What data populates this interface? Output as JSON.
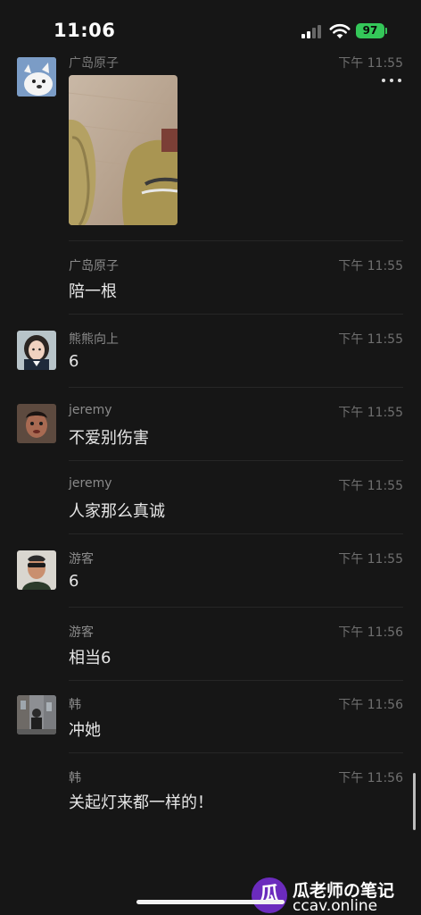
{
  "status_bar": {
    "time": "11:06",
    "battery": "97"
  },
  "messages": [
    {
      "sender": "广岛原子",
      "time": "下午 11:55",
      "text": "",
      "kind": "image"
    },
    {
      "sender": "广岛原子",
      "time": "下午 11:55",
      "text": "陪一根"
    },
    {
      "sender": "熊熊向上",
      "time": "下午 11:55",
      "text": "6"
    },
    {
      "sender": "jeremy",
      "time": "下午 11:55",
      "text": "不爱别伤害"
    },
    {
      "sender": "jeremy",
      "time": "下午 11:55",
      "text": "人家那么真诚"
    },
    {
      "sender": "游客",
      "time": "下午 11:55",
      "text": "6"
    },
    {
      "sender": "游客",
      "time": "下午 11:56",
      "text": "相当6"
    },
    {
      "sender": "韩",
      "time": "下午 11:56",
      "text": "冲她"
    },
    {
      "sender": "韩",
      "time": "下午 11:56",
      "text": "关起灯来都一样的！"
    }
  ],
  "watermark": {
    "logo_text": "瓜",
    "title": "瓜老师の笔记",
    "url": "ccav.online"
  },
  "colors": {
    "background": "#161616",
    "battery": "#34c759",
    "watermark_logo": "#6b2bbd"
  },
  "icons": [
    "signal-icon",
    "wifi-icon",
    "battery-icon",
    "more-options-icon"
  ]
}
